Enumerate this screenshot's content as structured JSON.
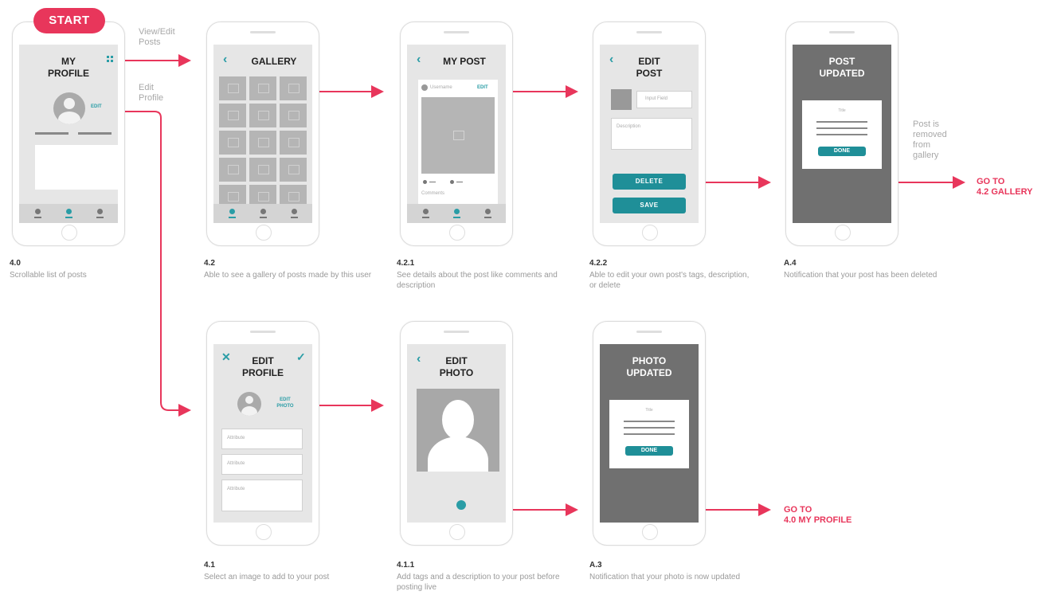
{
  "start_label": "START",
  "flow_labels": {
    "view_edit_posts": "View/Edit Posts",
    "edit_profile": "Edit Profile",
    "post_removed": "Post is removed from gallery"
  },
  "goto": {
    "gallery_line1": "GO TO",
    "gallery_line2": "4.2 GALLERY",
    "profile_line1": "GO TO",
    "profile_line2": "4.0 MY PROFILE"
  },
  "screens": {
    "my_profile": {
      "title": "MY PROFILE",
      "edit": "EDIT"
    },
    "gallery": {
      "title": "GALLERY"
    },
    "my_post": {
      "title": "MY POST",
      "username": "Username",
      "edit": "EDIT",
      "comments": "Comments"
    },
    "edit_post": {
      "title": "EDIT POST",
      "input_field": "Input Field",
      "description": "Description",
      "delete": "DELETE",
      "save": "SAVE"
    },
    "post_updated": {
      "title": "POST UPDATED",
      "modal_title": "Title",
      "done": "DONE"
    },
    "edit_profile": {
      "title": "EDIT PROFILE",
      "edit_photo": "EDIT PHOTO",
      "attributes": [
        "Attribute",
        "Attribute",
        "Attribute"
      ]
    },
    "edit_photo": {
      "title": "EDIT PHOTO"
    },
    "photo_updated": {
      "title": "PHOTO UPDATED",
      "modal_title": "Title",
      "done": "DONE"
    }
  },
  "captions": [
    {
      "num": "4.0",
      "desc": "Scrollable list of posts"
    },
    {
      "num": "4.2",
      "desc": "Able to see a gallery of posts made by this user"
    },
    {
      "num": "4.2.1",
      "desc": "See details about the post like comments and description"
    },
    {
      "num": "4.2.2",
      "desc": "Able to edit your own post's tags, description, or delete"
    },
    {
      "num": "A.4",
      "desc": "Notification that your post has been deleted"
    },
    {
      "num": "4.1",
      "desc": "Select an image to add to your post"
    },
    {
      "num": "4.1.1",
      "desc": "Add tags and a description to your post before posting live"
    },
    {
      "num": "A.3",
      "desc": "Notification that your photo is now updated"
    }
  ],
  "colors": {
    "accent_red": "#e8365b",
    "teal": "#2a9da6"
  }
}
